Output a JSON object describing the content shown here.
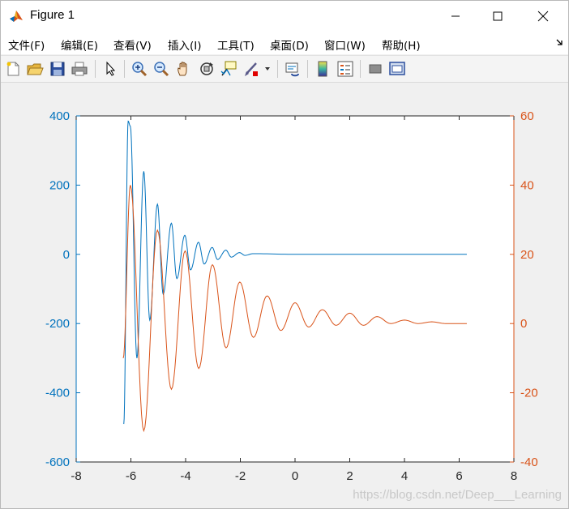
{
  "window": {
    "title": "Figure 1",
    "controls": [
      "minimize",
      "maximize",
      "close"
    ]
  },
  "menu": {
    "items": [
      "文件(F)",
      "编辑(E)",
      "查看(V)",
      "插入(I)",
      "工具(T)",
      "桌面(D)",
      "窗口(W)",
      "帮助(H)"
    ]
  },
  "toolbar": {
    "buttons": [
      "new-figure-icon",
      "open-file-icon",
      "save-icon",
      "print-icon",
      "edit-plot-arrow-icon",
      "zoom-in-icon",
      "zoom-out-icon",
      "pan-hand-icon",
      "rotate-3d-icon",
      "data-cursor-icon",
      "brush-icon",
      "brush-dropdown-icon",
      "link-plot-icon",
      "insert-colorbar-icon",
      "insert-legend-icon",
      "hide-plot-tools-icon",
      "show-plot-tools-icon"
    ]
  },
  "chart_data": {
    "type": "line",
    "title": "",
    "xlabel": "",
    "ylabel_left": "",
    "ylabel_right": "",
    "xlim": [
      -8,
      8
    ],
    "xticks": [
      "-8",
      "-6",
      "-4",
      "-2",
      "0",
      "2",
      "4",
      "6",
      "8"
    ],
    "y_left": {
      "lim": [
        -600,
        400
      ],
      "ticks": [
        "-600",
        "-400",
        "-200",
        "0",
        "200",
        "400"
      ],
      "color": "#0072bd"
    },
    "y_right": {
      "lim": [
        -40,
        60
      ],
      "ticks": [
        "-40",
        "-20",
        "0",
        "20",
        "40",
        "60"
      ],
      "color": "#d95319"
    },
    "grid": false,
    "legend": "none",
    "series": [
      {
        "axis": "left",
        "color": "#0072bd",
        "x_range": [
          -6.28,
          6.28
        ],
        "x": [
          -6.26,
          -6.1,
          -6.02,
          -5.78,
          -5.53,
          -5.31,
          -5.03,
          -4.82,
          -4.52,
          -4.32,
          -4.03,
          -3.82,
          -3.53,
          -3.32,
          -3.03,
          -2.83,
          -2.53,
          -2.33,
          -2.03,
          -1.83,
          -1.53,
          0,
          6.28
        ],
        "y": [
          -490,
          385,
          370,
          -300,
          240,
          -190,
          145,
          -115,
          90,
          -70,
          55,
          -45,
          35,
          -28,
          20,
          -15,
          12,
          -8,
          5,
          -3,
          2,
          0,
          0
        ]
      },
      {
        "axis": "right",
        "color": "#d95319",
        "x_range": [
          -6.28,
          6.28
        ],
        "x": [
          -6.28,
          -6.02,
          -5.53,
          -5.03,
          -4.52,
          -4.02,
          -3.52,
          -3.02,
          -2.52,
          -2.02,
          -1.52,
          -1.02,
          -0.52,
          0,
          0.5,
          1,
          1.5,
          2,
          2.5,
          3,
          3.5,
          4,
          4.5,
          5,
          5.5,
          6,
          6.28
        ],
        "y": [
          -10,
          40,
          -31,
          27,
          -19,
          21,
          -13,
          17,
          -7,
          12,
          -4,
          8,
          -2,
          6,
          -1,
          4,
          -0.5,
          3,
          -0.5,
          2,
          0,
          1,
          0,
          0.5,
          0,
          0,
          0
        ]
      }
    ]
  },
  "watermark": "https://blog.csdn.net/Deep___Learning"
}
